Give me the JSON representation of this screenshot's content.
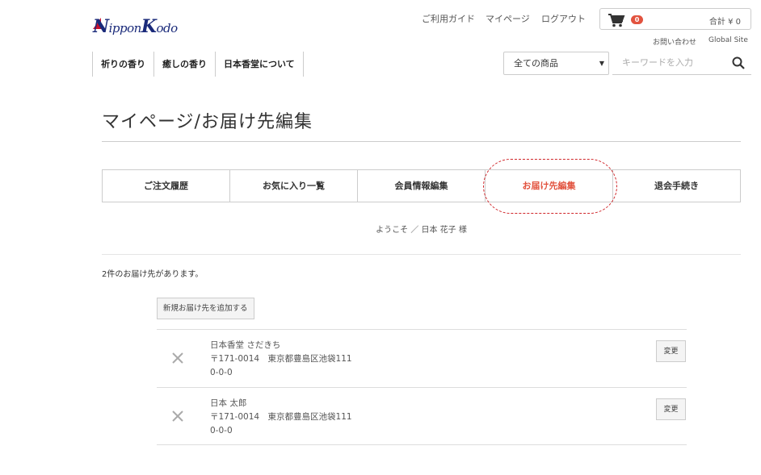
{
  "brand": {
    "logo_text_1": "N",
    "logo_text_2": "ippon",
    "logo_text_3": "K",
    "logo_text_4": "odo",
    "logo_color": "#1a2a7a"
  },
  "header": {
    "links": [
      "ご利用ガイド",
      "マイページ",
      "ログアウト"
    ],
    "cart_count": "0",
    "cart_total": "合計 ¥ 0",
    "sub_links": [
      "お問い合わせ",
      "Global Site"
    ]
  },
  "nav": {
    "items": [
      "祈りの香り",
      "癒しの香り",
      "日本香堂について"
    ]
  },
  "search": {
    "category_selected": "全ての商品",
    "placeholder": "キーワードを入力"
  },
  "page": {
    "title": "マイページ/お届け先編集",
    "tabs": [
      {
        "label": "ご注文履歴",
        "active": false
      },
      {
        "label": "お気に入り一覧",
        "active": false
      },
      {
        "label": "会員情報編集",
        "active": false
      },
      {
        "label": "お届け先編集",
        "active": true
      },
      {
        "label": "退会手続き",
        "active": false
      }
    ],
    "welcome": "ようこそ ／ 日本 花子 様",
    "count_text": "2件のお届け先があります。",
    "add_button": "新規お届け先を追加する",
    "addresses": [
      {
        "name": "日本香堂 さだきち",
        "postal_address": "〒171-0014　東京都豊島区池袋111",
        "detail": "0-0-0",
        "edit_label": "変更"
      },
      {
        "name": "日本 太郎",
        "postal_address": "〒171-0014　東京都豊島区池袋111",
        "detail": "0-0-0",
        "edit_label": "変更"
      }
    ]
  },
  "colors": {
    "accent": "#e2533f",
    "highlight": "#d0262a"
  }
}
